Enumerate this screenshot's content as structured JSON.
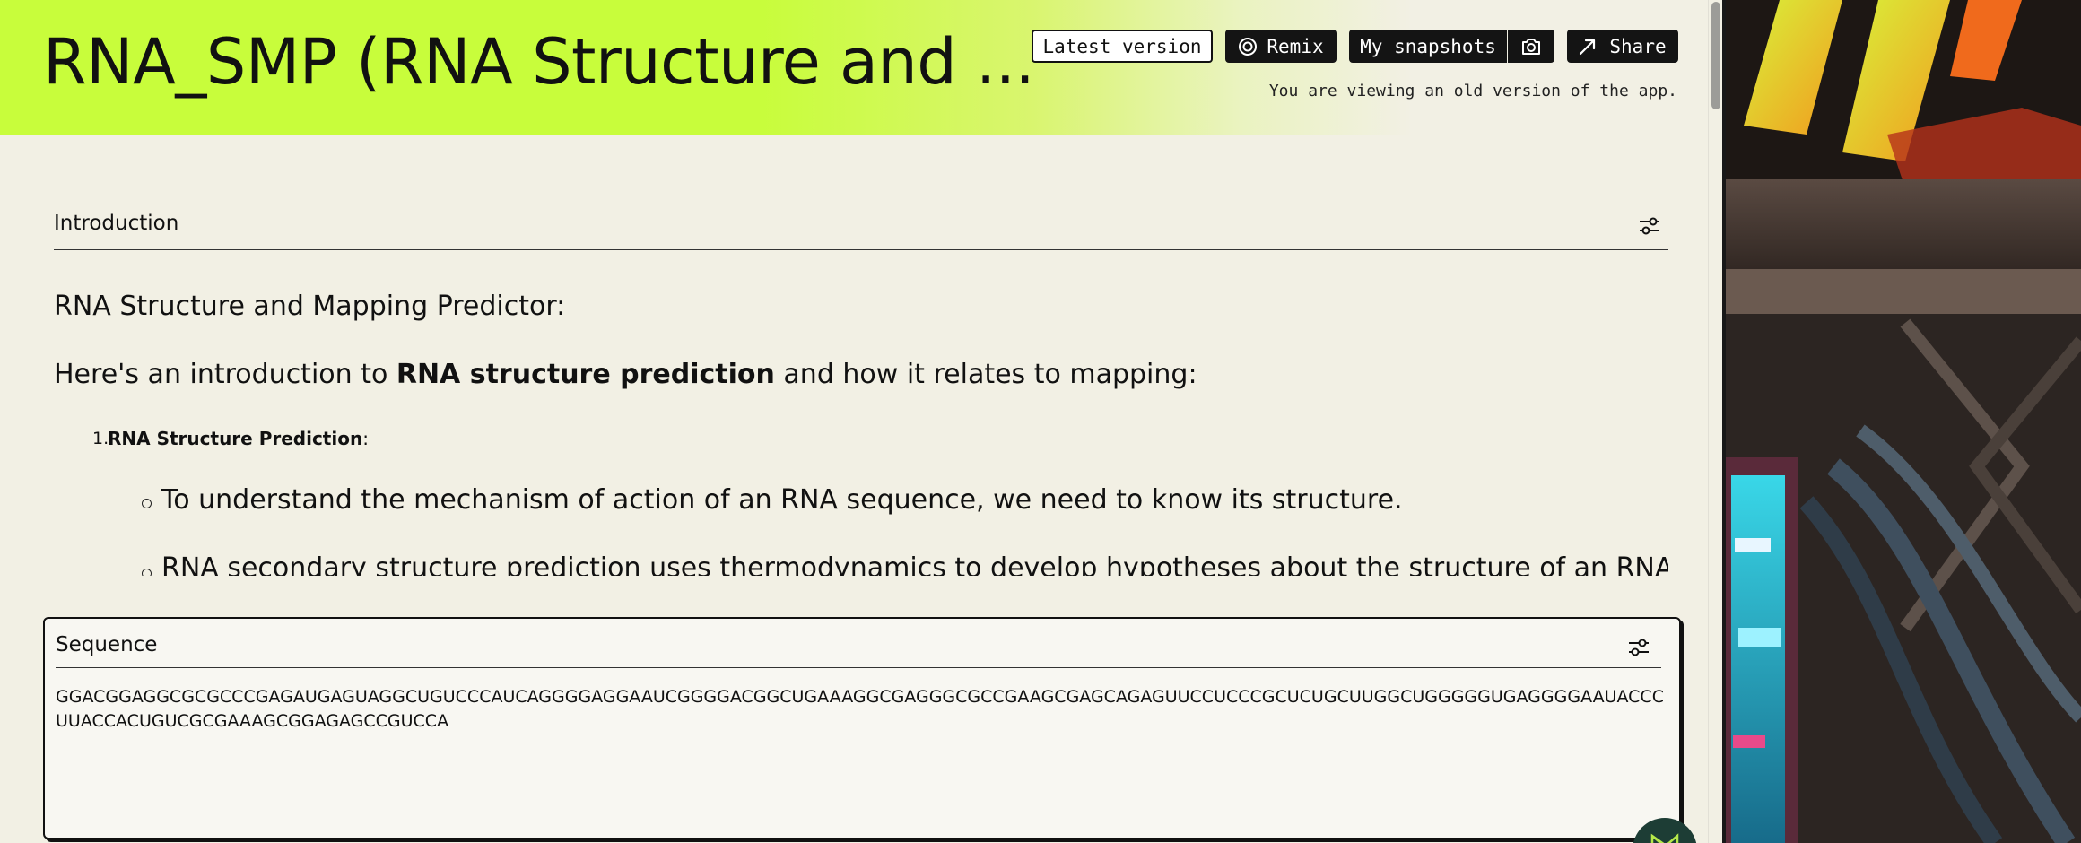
{
  "header": {
    "title": "RNA_SMP (RNA Structure and ...",
    "old_version_note": "You are viewing an old version of the app.",
    "accent_color": "#c8fd3b"
  },
  "toolbar": {
    "latest_version_label": "Latest version",
    "remix_label": "Remix",
    "snapshots_label": "My snapshots",
    "share_label": "Share"
  },
  "intro": {
    "section_title": "Introduction",
    "heading": "RNA Structure and Mapping Predictor:",
    "line_prefix": "Here's an introduction to ",
    "line_bold": "RNA structure prediction",
    "line_suffix": " and how it relates to mapping:",
    "list_number": "1.",
    "list_item_bold": "RNA Structure Prediction",
    "list_item_suffix": ":",
    "bullets": [
      "To understand the mechanism of action of an RNA sequence, we need to know its structure.",
      "RNA secondary structure prediction uses thermodynamics to develop hypotheses about the structure of an RNA"
    ]
  },
  "sequence": {
    "section_title": "Sequence",
    "value": "GGACGGAGGCGCGCCCGAGAUGAGUAGGCUGUCCCAUCAGGGGAGGAAUCGGGGACGGCUGAAAGGCGAGGGCGCCGAAGCGAGCAGAGUUCCUCCCGCUCUGCUUGGCUGGGGGUGAGGGGAAUACCCUUACCACUGUCGCGAAAGCGGAGAGCCGUCCA"
  },
  "icons": {
    "remix": "remix-icon",
    "camera": "camera-icon",
    "share": "share-arrow-icon",
    "settings": "settings-sliders-icon"
  }
}
